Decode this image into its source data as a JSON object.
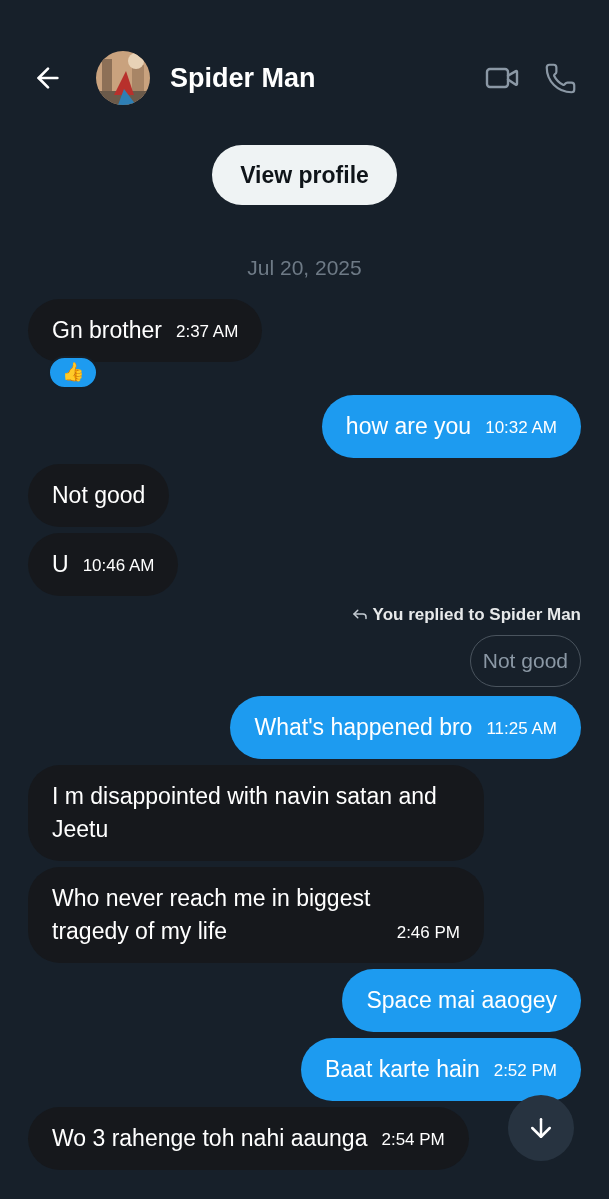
{
  "header": {
    "title": "Spider Man"
  },
  "view_profile": "View profile",
  "date": "Jul 20, 2025",
  "messages": [
    {
      "kind": "incoming",
      "text": "Gn brother",
      "time": "2:37 AM",
      "reaction": "👍"
    },
    {
      "kind": "outgoing",
      "text": "how are you",
      "time": "10:32 AM"
    },
    {
      "kind": "incoming",
      "text": "Not good"
    },
    {
      "kind": "incoming",
      "text": "U",
      "time": "10:46 AM"
    },
    {
      "kind": "outgoing",
      "reply_label": "You replied to Spider Man",
      "quote": "Not good",
      "text": "What's happened bro",
      "time": "11:25 AM"
    },
    {
      "kind": "incoming",
      "text": "I m disappointed with navin satan and Jeetu"
    },
    {
      "kind": "incoming",
      "text": "Who never reach me in biggest tragedy of my life",
      "time": "2:46 PM"
    },
    {
      "kind": "outgoing",
      "text": "Space mai aaogey"
    },
    {
      "kind": "outgoing",
      "text": "Baat karte hain",
      "time": "2:52 PM"
    },
    {
      "kind": "incoming",
      "text": "Wo 3 rahenge toh nahi aaunga",
      "time": "2:54 PM"
    }
  ]
}
